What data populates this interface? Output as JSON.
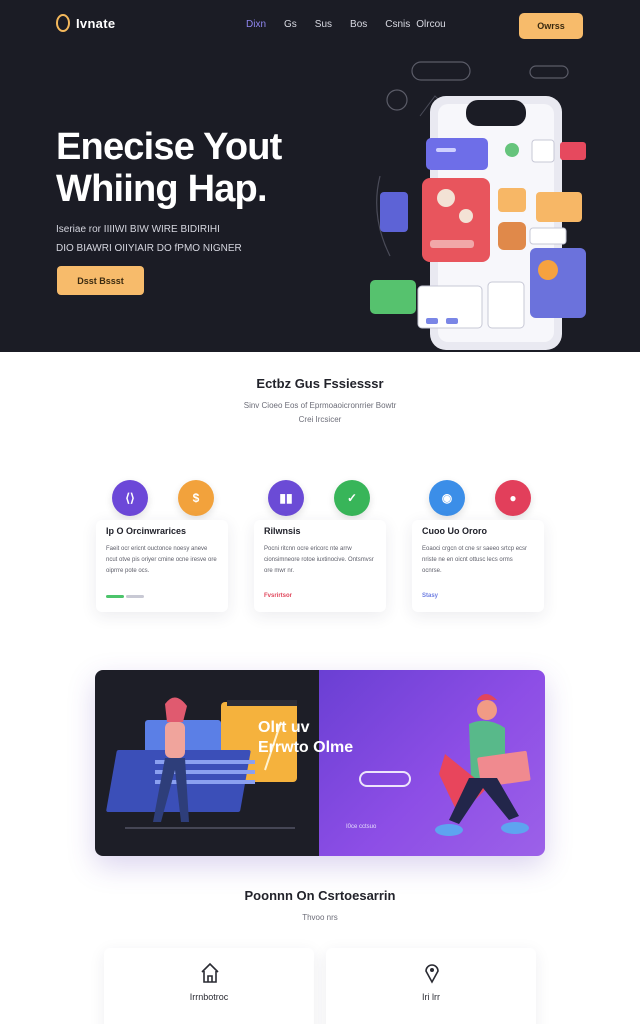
{
  "nav": {
    "logo": "Ivnate",
    "links": [
      "Dixn",
      "Gs",
      "Sus",
      "Bos",
      "Csnis",
      "Olrcou"
    ],
    "active_link_index": 0,
    "cta": "Owrss"
  },
  "hero": {
    "title_line1": "Enecise Yout",
    "title_line2": "Whiing Hap.",
    "description_line1": "Iseriae ror IIIIWI BIW WIRE BIDIRIHI",
    "description_line2": "DIO BIAWRI OIIYIAIR DO fPMO NIGNER",
    "cta": "Dsst Bssst"
  },
  "features": {
    "title": "Ectbz Gus Fssiesssr",
    "subtitle_line1": "Sinv Cioeo Eos of Eprmoaoicronrrier Bowtr",
    "subtitle_line2": "Crei Ircsicer",
    "cards": [
      {
        "title": "Ip O Orcinwrarices",
        "text": "Faeit ocr ericnt ouctonce noesy aneve ncut otve pis oriyer cmine ocne iresve ore oiprrre pote ocs.",
        "link": "",
        "link_color": "#4cc46b",
        "icons": [
          "#6c48d8",
          "#f2a23c"
        ]
      },
      {
        "title": "Rilwnsis",
        "text": "Pocni ritcnn ocre ericorc nte arrw cionsimneore rotoe iuxtinocive. Ontsmvsr ore mwr nr.",
        "link": "Fvsrirtsor",
        "link_color": "#e0475c",
        "icons": [
          "#6b4bd6",
          "#38b559"
        ]
      },
      {
        "title": "Cuoo Uo Ororo",
        "text": "Eoaoci crgcn ot cne sr saeeo srtcp ecsr nriste ne en oicnt ottusc lecs orms ocnrse.",
        "link": "Stasy",
        "link_color": "#6e7ee2",
        "icons": [
          "#3b8ee8",
          "#e23f5b"
        ]
      }
    ]
  },
  "banner": {
    "title_line1": "Olrt uv",
    "title_line2": "Errwto Olme",
    "caption": "I0ce cctsuo",
    "colors": {
      "left": "#1d1e27",
      "right_start": "#6a3fd3",
      "right_end": "#9c61e8"
    }
  },
  "bottom": {
    "title": "Poonnn On Csrtoesarrin",
    "subtitle": "Thvoo nrs",
    "cards": [
      {
        "icon": "home-icon",
        "title": "Irrnbotroc"
      },
      {
        "icon": "pin-icon",
        "title": "Iri lrr"
      }
    ]
  },
  "colors": {
    "dark_bg": "#1b1c25",
    "accent_orange": "#f7bb6b",
    "accent_purple": "#8f86f0"
  }
}
